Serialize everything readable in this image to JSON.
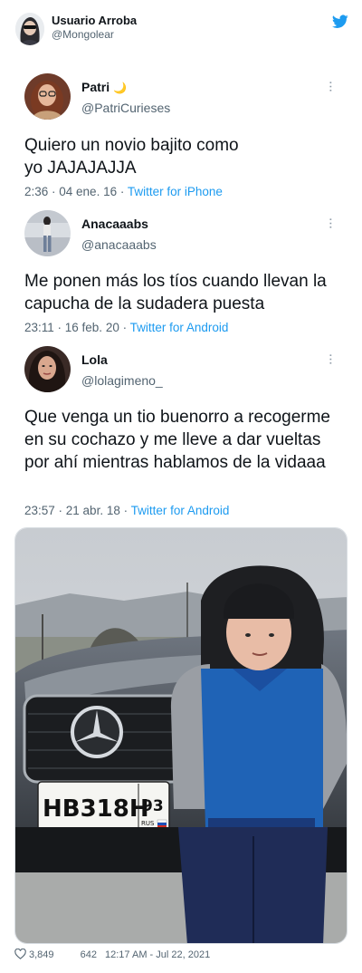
{
  "header": {
    "name": "Usuario Arroba",
    "handle": "@Mongolear",
    "logo_icon": "twitter-bird-icon",
    "accent": "#1d9bf0"
  },
  "quotes": [
    {
      "name": "Patri",
      "name_emoji": "🌙",
      "handle": "@PatriCurieses",
      "text": "Quiero un novio bajito como yo JAJAJAJJA",
      "time": "2:36 · 04 ene. 16 · ",
      "source": "Twitter for iPhone"
    },
    {
      "name": "Anacaaabs",
      "handle": "@anacaaabs",
      "text": "Me ponen más los tíos cuando llevan la capucha de la sudadera puesta",
      "time": "23:11 · 16 feb. 20 · ",
      "source": "Twitter for Android"
    },
    {
      "name": "Lola",
      "handle": "@lolagimeno_",
      "text": "Que venga un tio buenorro a recogerme en su cochazo y me lleve a dar vueltas por ahí mientras hablamos de la vidaaa",
      "time": "23:57 · 21 abr. 18 · ",
      "source": "Twitter for Android"
    }
  ],
  "photo": {
    "plate": "НВ318Н",
    "region": "93",
    "country": "RUS"
  },
  "footer": {
    "likes": "3,849",
    "replies": "642",
    "timestamp": "12:17 AM - Jul 22, 2021"
  }
}
